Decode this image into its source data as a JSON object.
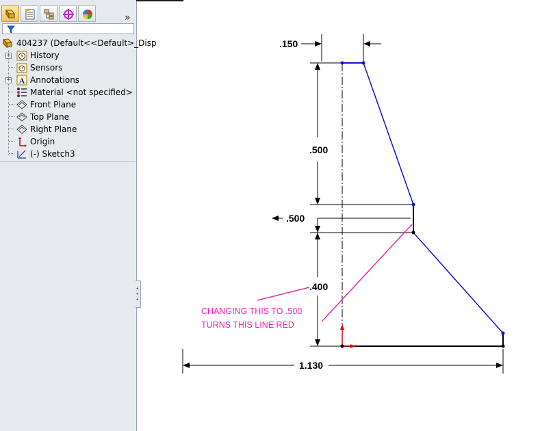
{
  "tree": {
    "root": "404237  (Default<<Default>_Disp",
    "items": [
      {
        "label": "History",
        "icon": "history-icon",
        "expandable": true
      },
      {
        "label": "Sensors",
        "icon": "sensors-icon",
        "expandable": false
      },
      {
        "label": "Annotations",
        "icon": "annotations-icon",
        "expandable": true
      },
      {
        "label": "Material <not specified>",
        "icon": "material-icon",
        "expandable": false
      },
      {
        "label": "Front Plane",
        "icon": "plane-icon",
        "expandable": false
      },
      {
        "label": "Top Plane",
        "icon": "plane-icon",
        "expandable": false
      },
      {
        "label": "Right Plane",
        "icon": "plane-icon",
        "expandable": false
      },
      {
        "label": "Origin",
        "icon": "origin-icon",
        "expandable": false
      },
      {
        "label": "(-) Sketch3",
        "icon": "sketch-icon",
        "expandable": false
      }
    ]
  },
  "toolbar": {
    "tabs": [
      "feature-manager-tab",
      "property-manager-tab",
      "configuration-manager-tab",
      "dimxpert-manager-tab",
      "display-manager-tab"
    ],
    "more_label": "»"
  },
  "sketch": {
    "dimensions": {
      "top_width": ".150",
      "upper_height": ".500",
      "vertical_gap": ".500",
      "lower_height": ".400",
      "total_width": "1.130"
    },
    "annotation_line1": "CHANGING THIS TO .500",
    "annotation_line2": "TURNS THIS LINE RED",
    "colors": {
      "sketch_line": "#1010d0",
      "fixed_line": "#000000",
      "annotation": "#e427b4",
      "origin": "#e00000"
    }
  }
}
